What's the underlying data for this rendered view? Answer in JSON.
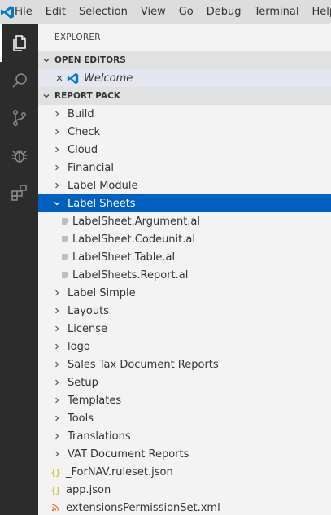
{
  "menu": [
    "File",
    "Edit",
    "Selection",
    "View",
    "Go",
    "Debug",
    "Terminal",
    "Help"
  ],
  "sidebar": {
    "title": "EXPLORER",
    "open_editors": {
      "header": "OPEN EDITORS",
      "items": [
        {
          "label": "Welcome"
        }
      ]
    },
    "project": {
      "header": "REPORT PACK",
      "items": [
        {
          "label": "Build",
          "type": "folder"
        },
        {
          "label": "Check",
          "type": "folder"
        },
        {
          "label": "Cloud",
          "type": "folder"
        },
        {
          "label": "Financial",
          "type": "folder"
        },
        {
          "label": "Label Module",
          "type": "folder"
        },
        {
          "label": "Label Sheets",
          "type": "folder-open",
          "selected": true
        },
        {
          "label": "LabelSheet.Argument.al",
          "type": "file-al"
        },
        {
          "label": "LabelSheet.Codeunit.al",
          "type": "file-al"
        },
        {
          "label": "LabelSheet.Table.al",
          "type": "file-al"
        },
        {
          "label": "LabelSheets.Report.al",
          "type": "file-al"
        },
        {
          "label": "Label Simple",
          "type": "folder"
        },
        {
          "label": "Layouts",
          "type": "folder"
        },
        {
          "label": "License",
          "type": "folder"
        },
        {
          "label": "logo",
          "type": "folder"
        },
        {
          "label": "Sales Tax Document Reports",
          "type": "folder"
        },
        {
          "label": "Setup",
          "type": "folder"
        },
        {
          "label": "Templates",
          "type": "folder"
        },
        {
          "label": "Tools",
          "type": "folder"
        },
        {
          "label": "Translations",
          "type": "folder"
        },
        {
          "label": "VAT Document Reports",
          "type": "folder"
        },
        {
          "label": "_ForNAV.ruleset.json",
          "type": "file-json"
        },
        {
          "label": "app.json",
          "type": "file-json"
        },
        {
          "label": "extensionsPermissionSet.xml",
          "type": "file-xml"
        }
      ]
    }
  },
  "activity_icons": [
    "explorer-icon",
    "search-icon",
    "source-control-icon",
    "debug-icon",
    "extensions-icon"
  ],
  "colors": {
    "selection": "#0060c0",
    "activitybar": "#2c2c2c",
    "titlebar": "#dddddd",
    "sidebar": "#f3f3f3",
    "vscode_blue": "#007acc"
  }
}
